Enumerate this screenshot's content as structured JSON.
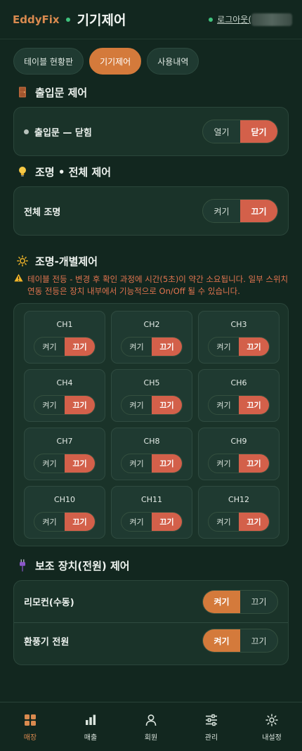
{
  "header": {
    "brand": "EddyFix",
    "title": "기기제어",
    "logout": "로그아웃("
  },
  "tabs": [
    {
      "label": "테이블 현황판",
      "active": false
    },
    {
      "label": "기기제어",
      "active": true
    },
    {
      "label": "사용내역",
      "active": false
    }
  ],
  "door": {
    "title": "출입문 제어",
    "status_label": "출입문 — 닫힘",
    "open_label": "열기",
    "close_label": "닫기"
  },
  "light_all": {
    "title": "조명 • 전체 제어",
    "label": "전체 조명",
    "on_label": "켜기",
    "off_label": "끄기"
  },
  "light_individual": {
    "title": "조명-개별제어",
    "warning": "테이블 전등 - 변경 후 확인 과정에 시간(5초)이 약간 소요됩니다. 일부 스위치연동 전등은 장치 내부에서 기능적으로 On/Off 될 수 있습니다.",
    "on_label": "켜기",
    "off_label": "끄기",
    "channels": [
      "CH1",
      "CH2",
      "CH3",
      "CH4",
      "CH5",
      "CH6",
      "CH7",
      "CH8",
      "CH9",
      "CH10",
      "CH11",
      "CH12"
    ]
  },
  "aux": {
    "title": "보조 장치(전원) 제어",
    "items": [
      {
        "label": "리모컨(수동)",
        "on_label": "켜기",
        "off_label": "끄기"
      },
      {
        "label": "환풍기 전원",
        "on_label": "켜기",
        "off_label": "끄기"
      }
    ]
  },
  "nav": [
    {
      "label": "매장",
      "icon": "grid-icon",
      "active": true
    },
    {
      "label": "매출",
      "icon": "bar-chart-icon",
      "active": false
    },
    {
      "label": "회원",
      "icon": "person-icon",
      "active": false
    },
    {
      "label": "관리",
      "icon": "sliders-icon",
      "active": false
    },
    {
      "label": "내설정",
      "icon": "gear-icon",
      "active": false
    }
  ],
  "colors": {
    "accent_orange": "#d47a3b",
    "accent_red": "#d3604a",
    "status_green": "#3fc27d",
    "background": "#12271f"
  }
}
